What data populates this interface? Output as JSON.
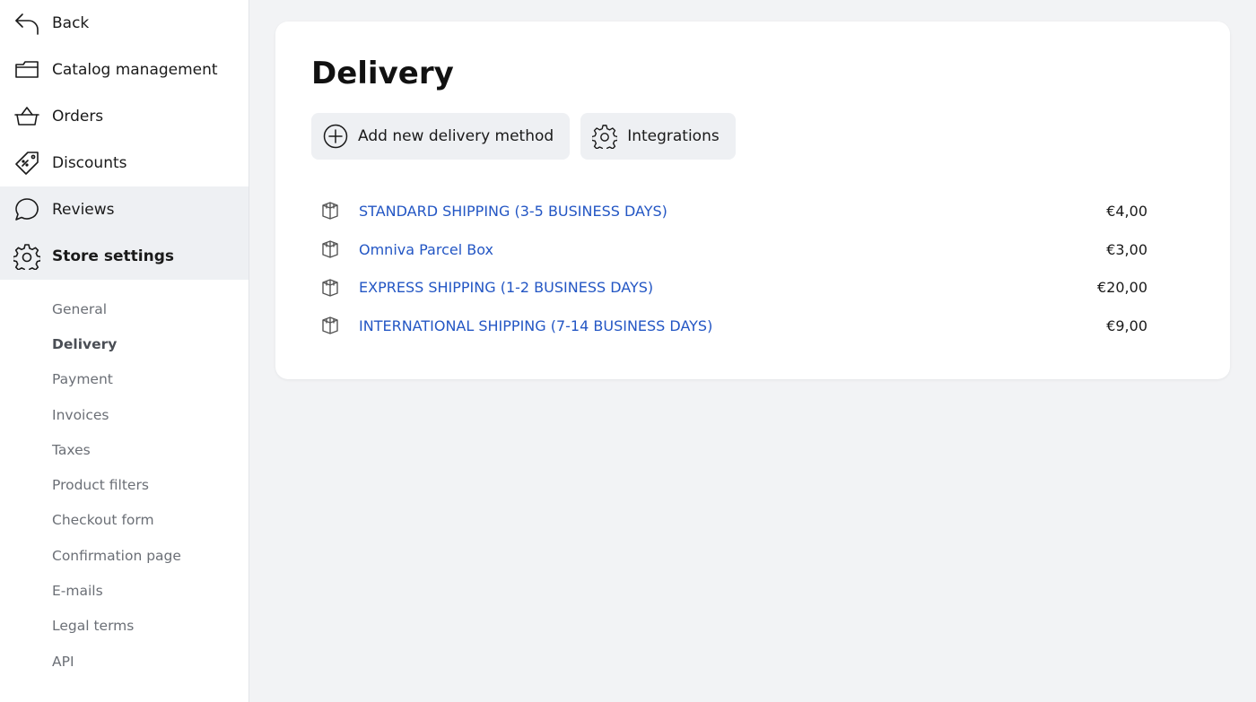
{
  "sidebar": {
    "items": [
      {
        "label": "Back",
        "icon": "back-arrow-icon"
      },
      {
        "label": "Catalog management",
        "icon": "folder-icon"
      },
      {
        "label": "Orders",
        "icon": "basket-icon"
      },
      {
        "label": "Discounts",
        "icon": "tag-icon"
      },
      {
        "label": "Reviews",
        "icon": "chat-bubble-icon"
      },
      {
        "label": "Store settings",
        "icon": "gear-icon"
      }
    ],
    "subitems": [
      "General",
      "Delivery",
      "Payment",
      "Invoices",
      "Taxes",
      "Product filters",
      "Checkout form",
      "Confirmation page",
      "E-mails",
      "Legal terms",
      "API"
    ]
  },
  "main": {
    "title": "Delivery",
    "actions": {
      "add_label": "Add new delivery method",
      "integrations_label": "Integrations"
    },
    "methods": [
      {
        "name": "STANDARD SHIPPING (3-5 BUSINESS DAYS)",
        "price": "€4,00"
      },
      {
        "name": "Omniva Parcel Box",
        "price": "€3,00"
      },
      {
        "name": "EXPRESS SHIPPING (1-2 BUSINESS DAYS)",
        "price": "€20,00"
      },
      {
        "name": "INTERNATIONAL SHIPPING (7-14 BUSINESS DAYS)",
        "price": "€9,00"
      }
    ]
  },
  "colors": {
    "link": "#2356c4",
    "background": "#f2f3f5",
    "button_bg": "#eef0f3"
  }
}
